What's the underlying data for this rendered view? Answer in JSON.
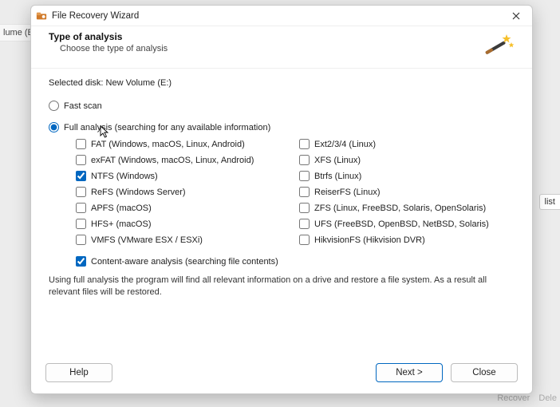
{
  "background": {
    "left_label": "lume (E:",
    "right_button": "list",
    "bottom_recover": "Recover",
    "bottom_delete": "Dele"
  },
  "titlebar": {
    "title": "File Recovery Wizard"
  },
  "header": {
    "title": "Type of analysis",
    "subtitle": "Choose the type of analysis"
  },
  "selected_disk": {
    "label": "Selected disk:",
    "value": "New Volume (E:)"
  },
  "scan": {
    "fast_label": "Fast scan",
    "full_label": "Full analysis (searching for any available information)",
    "selected": "full"
  },
  "filesystems": {
    "left": [
      {
        "label": "FAT (Windows, macOS, Linux, Android)",
        "checked": false
      },
      {
        "label": "exFAT (Windows, macOS, Linux, Android)",
        "checked": false
      },
      {
        "label": "NTFS (Windows)",
        "checked": true
      },
      {
        "label": "ReFS (Windows Server)",
        "checked": false
      },
      {
        "label": "APFS (macOS)",
        "checked": false
      },
      {
        "label": "HFS+ (macOS)",
        "checked": false
      },
      {
        "label": "VMFS (VMware ESX / ESXi)",
        "checked": false
      }
    ],
    "right": [
      {
        "label": "Ext2/3/4 (Linux)",
        "checked": false
      },
      {
        "label": "XFS (Linux)",
        "checked": false
      },
      {
        "label": "Btrfs (Linux)",
        "checked": false
      },
      {
        "label": "ReiserFS (Linux)",
        "checked": false
      },
      {
        "label": "ZFS (Linux, FreeBSD, Solaris, OpenSolaris)",
        "checked": false
      },
      {
        "label": "UFS (FreeBSD, OpenBSD, NetBSD, Solaris)",
        "checked": false
      },
      {
        "label": "HikvisionFS (Hikvision DVR)",
        "checked": false
      }
    ]
  },
  "content_aware": {
    "label": "Content-aware analysis (searching file contents)",
    "checked": true
  },
  "note": "Using full analysis the program will find all relevant information on a drive and restore a file system. As a result all relevant files will be restored.",
  "footer": {
    "help": "Help",
    "next": "Next >",
    "close": "Close"
  }
}
